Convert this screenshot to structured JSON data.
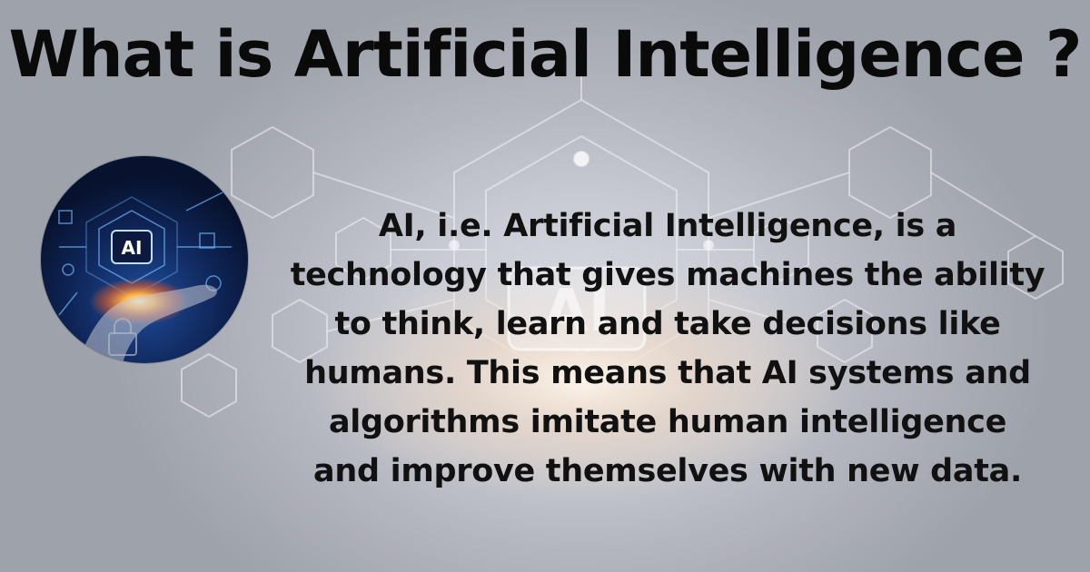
{
  "title": "What is Artificial Intelligence ?",
  "badge": {
    "chip_label": "AI"
  },
  "background": {
    "chip_label": "AI"
  },
  "description": {
    "lines": [
      "AI, i.e. Artificial Intelligence, is a",
      "technology that gives machines the ability",
      "to think, learn and take decisions like",
      "humans. This means that AI systems and",
      "algorithms imitate human intelligence",
      "and improve themselves with new data."
    ]
  },
  "colors": {
    "title": "#0a0a0a",
    "text": "#111111",
    "badge_bg": "#0b1a3e",
    "accent": "#ff9a3c"
  }
}
